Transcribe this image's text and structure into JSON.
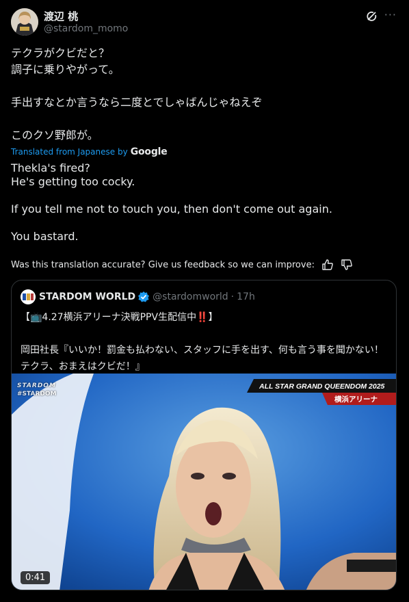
{
  "tweet": {
    "author_name": "渡辺 桃",
    "author_handle": "@stardom_momo",
    "more_label": "···",
    "jp_lines": [
      "テクラがクビだと？",
      "調子に乗りやがって。",
      "",
      "手出すなとか言うなら二度とでしゃばんじゃねえぞ",
      "",
      "このクソ野郎が。"
    ],
    "translated_from": "Translated from Japanese by",
    "translator": "Google",
    "en_lines": [
      "Thekla's fired?",
      "He's getting too cocky.",
      "",
      "If you tell me not to touch you, then don't come out again.",
      "",
      "You bastard."
    ],
    "feedback_text": "Was this translation accurate? Give us feedback so we can improve:"
  },
  "quoted": {
    "author_name": "STARDOM WORLD",
    "author_handle": "@stardomworld",
    "separator": "·",
    "time": "17h",
    "lines": [
      "【📺4.27横浜アリーナ決戦PPV生配信中‼️】",
      "",
      "岡田社長『いいか！罰金も払わない、スタッフに手を出す、何も言う事を聞かない！テクラ、おまえはクビだ！』"
    ],
    "video": {
      "duration": "0:41",
      "banner_title": "ALL STAR GRAND QUEENDOM 2025",
      "banner_venue": "横浜アリーナ",
      "watermark_tag": "#STARDOM"
    }
  },
  "colors": {
    "background": "#000000",
    "text": "#e7e9ea",
    "secondary": "#71767b",
    "link": "#1d9bf0",
    "border": "#2f3336"
  }
}
